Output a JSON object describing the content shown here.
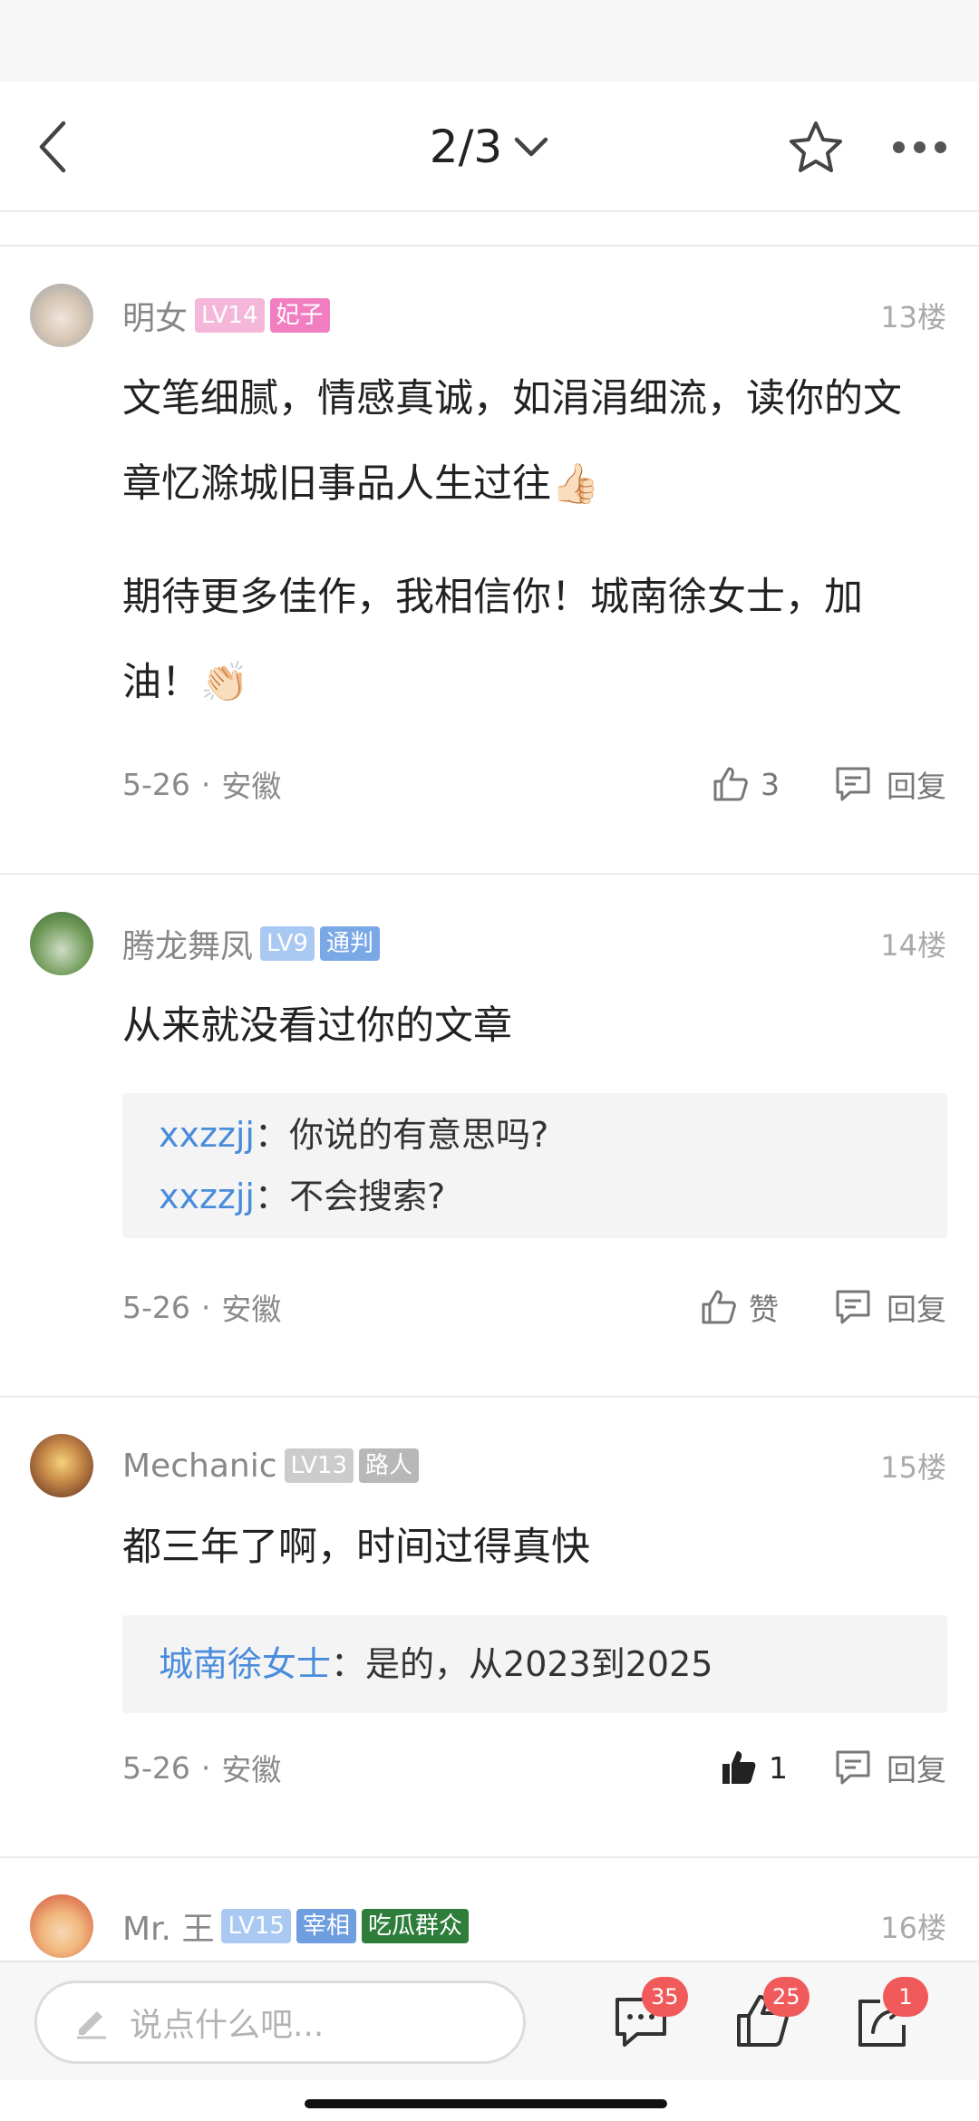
{
  "nav": {
    "page_indicator": "2/3"
  },
  "comments": [
    {
      "user": "明女",
      "level": "LV14",
      "title": "妃子",
      "level_color": "#f5b7d9",
      "title_color": "#f07ec0",
      "floor": "13楼",
      "paragraphs": [
        "文笔细腻，情感真诚，如涓涓细流，读你的文章忆滁城旧事品人生过往👍🏻",
        "期待更多佳作，我相信你！城南徐女士，加油！👏🏻"
      ],
      "date": "5-26",
      "location": "安徽",
      "like_label": "3",
      "reply_label": "回复"
    },
    {
      "user": "腾龙舞凤",
      "level": "LV9",
      "title": "通判",
      "level_color": "#a9c9f2",
      "title_color": "#7aa7e6",
      "floor": "14楼",
      "paragraphs": [
        "从来就没看过你的文章"
      ],
      "replies": [
        {
          "who": "xxzzjj",
          "text": "你说的有意思吗?"
        },
        {
          "who": "xxzzjj",
          "text": "不会搜索?"
        }
      ],
      "date": "5-26",
      "location": "安徽",
      "like_label": "赞",
      "reply_label": "回复"
    },
    {
      "user": "Mechanic",
      "level": "LV13",
      "title": "路人",
      "level_color": "#cccccc",
      "title_color": "#b8b8b8",
      "floor": "15楼",
      "paragraphs": [
        "都三年了啊，时间过得真快"
      ],
      "replies": [
        {
          "who": "城南徐女士",
          "text": "是的，从2023到2025"
        }
      ],
      "date": "5-26",
      "location": "安徽",
      "like_label": "1",
      "reply_label": "回复"
    },
    {
      "user": "Mr. 王",
      "level": "LV15",
      "title": "宰相",
      "extra_badge": "吃瓜群众",
      "level_color": "#a9c9f2",
      "title_color": "#6f9ee0",
      "extra_color": "#2f7d3a",
      "floor": "16楼"
    }
  ],
  "bottom": {
    "input_placeholder": "说点什么吧...",
    "comments_count": "35",
    "likes_count": "25",
    "share_count": "1"
  },
  "colors": {
    "accent_link": "#4a8cdc",
    "badge_red": "#f15a5a"
  }
}
